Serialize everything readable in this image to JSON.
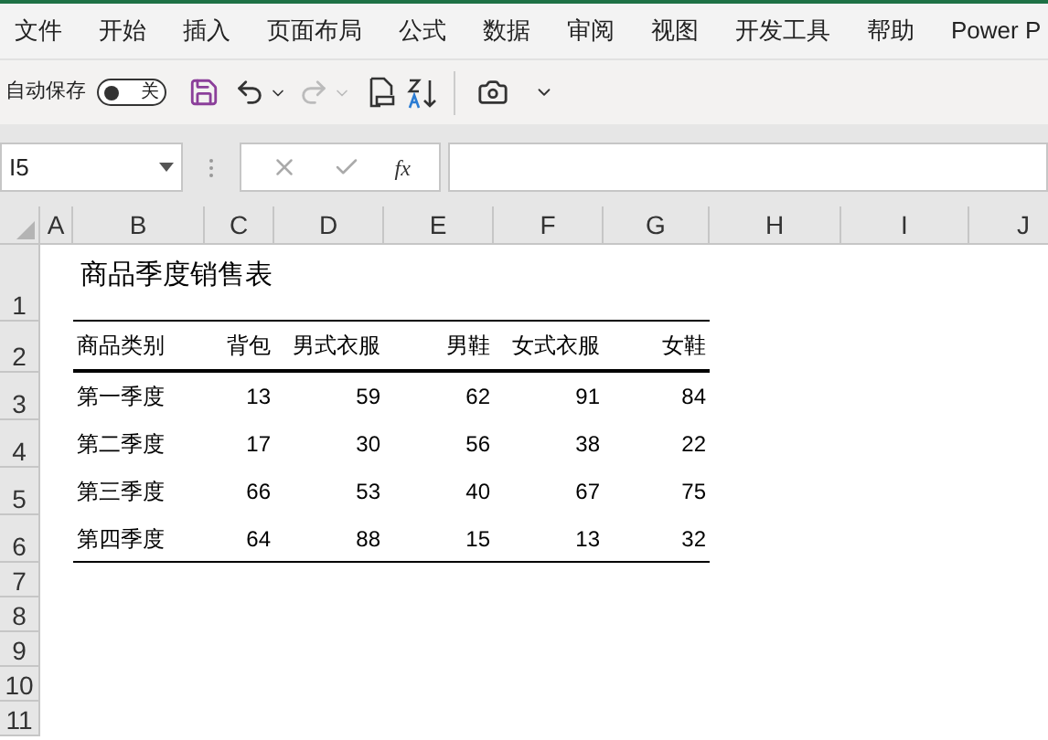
{
  "ribbon_tabs": [
    "文件",
    "开始",
    "插入",
    "页面布局",
    "公式",
    "数据",
    "审阅",
    "视图",
    "开发工具",
    "帮助",
    "Power P"
  ],
  "quick_access": {
    "autosave_label": "自动保存",
    "autosave_toggle": {
      "on": false,
      "label": "关"
    }
  },
  "name_box": {
    "value": "I5"
  },
  "formula_bar": {
    "function_label": "fx"
  },
  "column_headers": [
    "A",
    "B",
    "C",
    "D",
    "E",
    "F",
    "G",
    "H",
    "I",
    "J"
  ],
  "row_headers": [
    "1",
    "2",
    "3",
    "4",
    "5",
    "6",
    "7",
    "8",
    "9",
    "10",
    "11"
  ],
  "sheet": {
    "title": "商品季度销售表",
    "columns": [
      "商品类别",
      "背包",
      "男式衣服",
      "男鞋",
      "女式衣服",
      "女鞋"
    ],
    "rows": [
      [
        "第一季度",
        "13",
        "59",
        "62",
        "91",
        "84"
      ],
      [
        "第二季度",
        "17",
        "30",
        "56",
        "38",
        "22"
      ],
      [
        "第三季度",
        "66",
        "53",
        "40",
        "67",
        "75"
      ],
      [
        "第四季度",
        "64",
        "88",
        "15",
        "13",
        "32"
      ]
    ]
  }
}
